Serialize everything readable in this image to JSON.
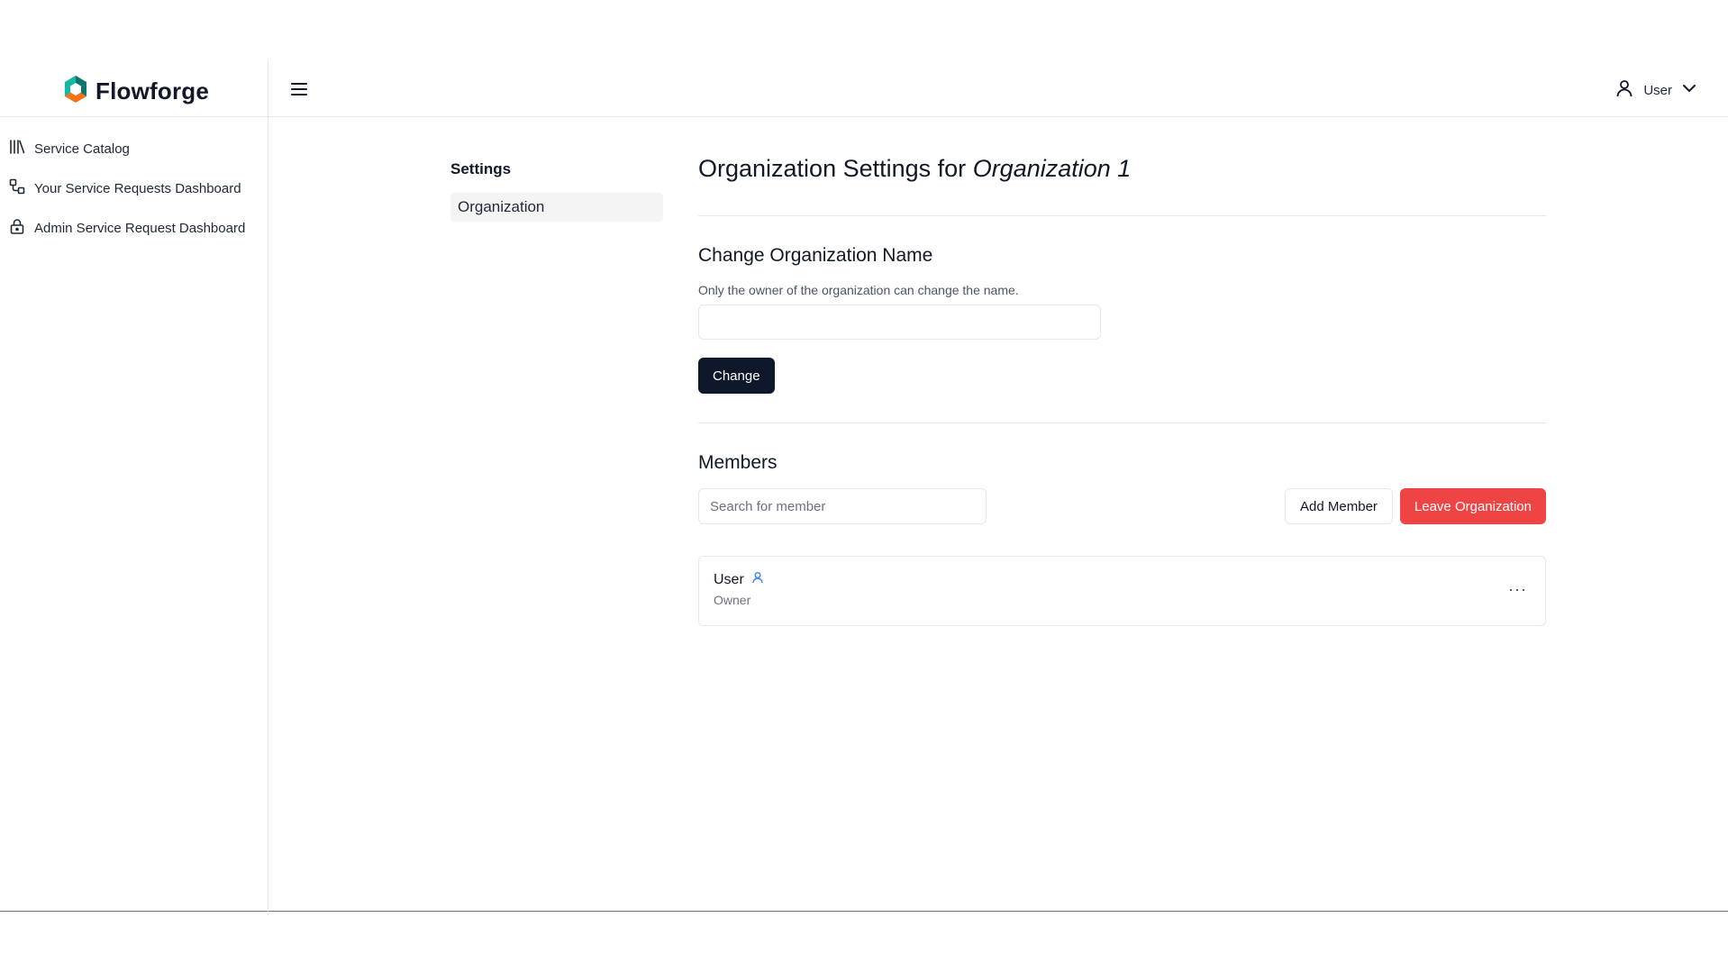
{
  "brand": {
    "name": "Flowforge"
  },
  "sidebar": {
    "items": [
      {
        "label": "Service Catalog",
        "icon": "library-icon"
      },
      {
        "label": "Your Service Requests Dashboard",
        "icon": "workflow-icon"
      },
      {
        "label": "Admin Service Request Dashboard",
        "icon": "lock-icon"
      }
    ]
  },
  "header": {
    "user_label": "User"
  },
  "settings_nav": {
    "title": "Settings",
    "items": [
      {
        "label": "Organization",
        "selected": true
      }
    ]
  },
  "main": {
    "title_prefix": "Organization Settings for",
    "title_org": "Organization 1",
    "change_name": {
      "title": "Change Organization Name",
      "hint": "Only the owner of the organization can change the name.",
      "input_value": "",
      "button": "Change"
    },
    "members": {
      "title": "Members",
      "search_placeholder": "Search for member",
      "add_button": "Add Member",
      "leave_button": "Leave Organization",
      "list": [
        {
          "name": "User",
          "role": "Owner"
        }
      ],
      "more_label": "···"
    }
  },
  "colors": {
    "dark_button": "#0f172a",
    "danger": "#ef4444",
    "accent_icon": "#3b82f6"
  }
}
